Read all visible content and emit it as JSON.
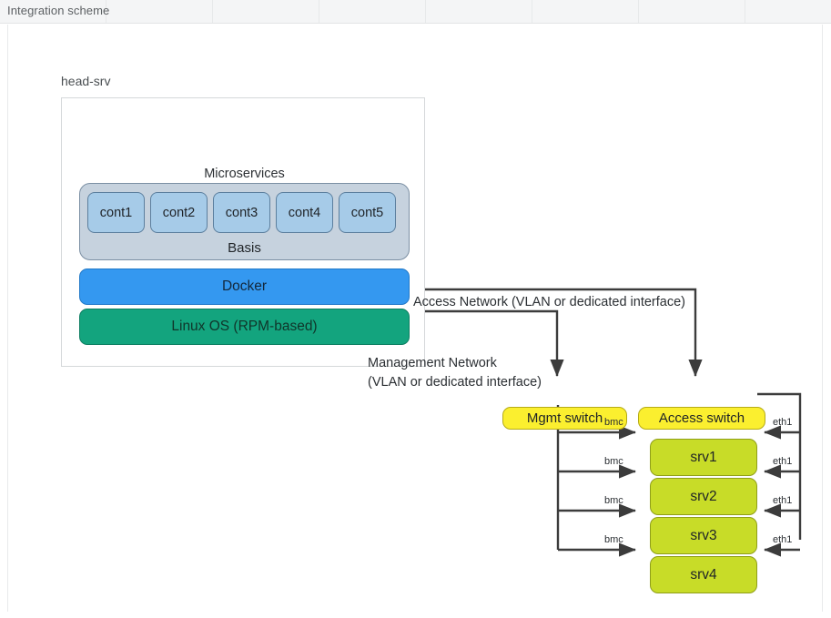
{
  "header": {
    "title": "Integration scheme"
  },
  "diagram": {
    "head_server": {
      "label": "head-srv",
      "microservices_label": "Microservices",
      "basis_label": "Basis",
      "containers": [
        {
          "label": "cont1"
        },
        {
          "label": "cont2"
        },
        {
          "label": "cont3"
        },
        {
          "label": "cont4"
        },
        {
          "label": "cont5"
        }
      ],
      "docker_label": "Docker",
      "os_label": "Linux OS (RPM-based)"
    },
    "networks": {
      "access_label": "Access Network (VLAN or dedicated interface)",
      "mgmt_label_line1": "Management Network",
      "mgmt_label_line2": "(VLAN or dedicated interface)"
    },
    "switches": {
      "mgmt": "Mgmt switch",
      "access": "Access switch"
    },
    "servers": [
      {
        "label": "srv1",
        "mgmt_port": "bmc",
        "access_port": "eth1"
      },
      {
        "label": "srv2",
        "mgmt_port": "bmc",
        "access_port": "eth1"
      },
      {
        "label": "srv3",
        "mgmt_port": "bmc",
        "access_port": "eth1"
      },
      {
        "label": "srv4",
        "mgmt_port": "bmc",
        "access_port": "eth1"
      }
    ],
    "colors": {
      "docker": "#3498f0",
      "os": "#13a47e",
      "basis": "#c6d2de",
      "container": "#a6cbe8",
      "switch": "#fbef2f",
      "server": "#c8dc28",
      "wire": "#3c3c3c"
    }
  }
}
